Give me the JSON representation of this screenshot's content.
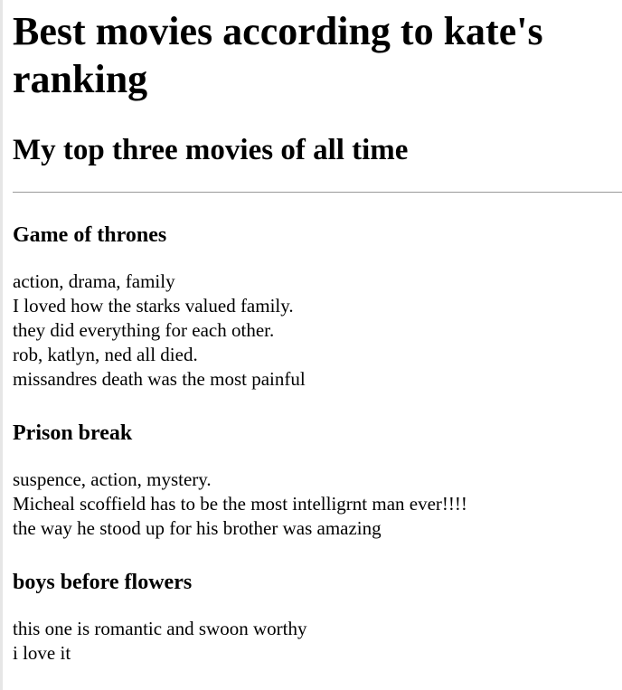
{
  "page_title": "Best movies according to kate's ranking",
  "subtitle": "My top three movies of all time",
  "movies": [
    {
      "title": "Game of thrones",
      "lines": [
        "action, drama, family",
        "I loved how the starks valued family.",
        "they did everything for each other.",
        "rob, katlyn, ned all died.",
        "missandres death was the most painful"
      ]
    },
    {
      "title": "Prison break",
      "lines": [
        "suspence, action, mystery.",
        "Micheal scoffield has to be the most intelligrnt man ever!!!!",
        "the way he stood up for his brother was amazing"
      ]
    },
    {
      "title": "boys before flowers",
      "lines": [
        "this one is romantic and swoon worthy",
        "i love it"
      ]
    }
  ]
}
